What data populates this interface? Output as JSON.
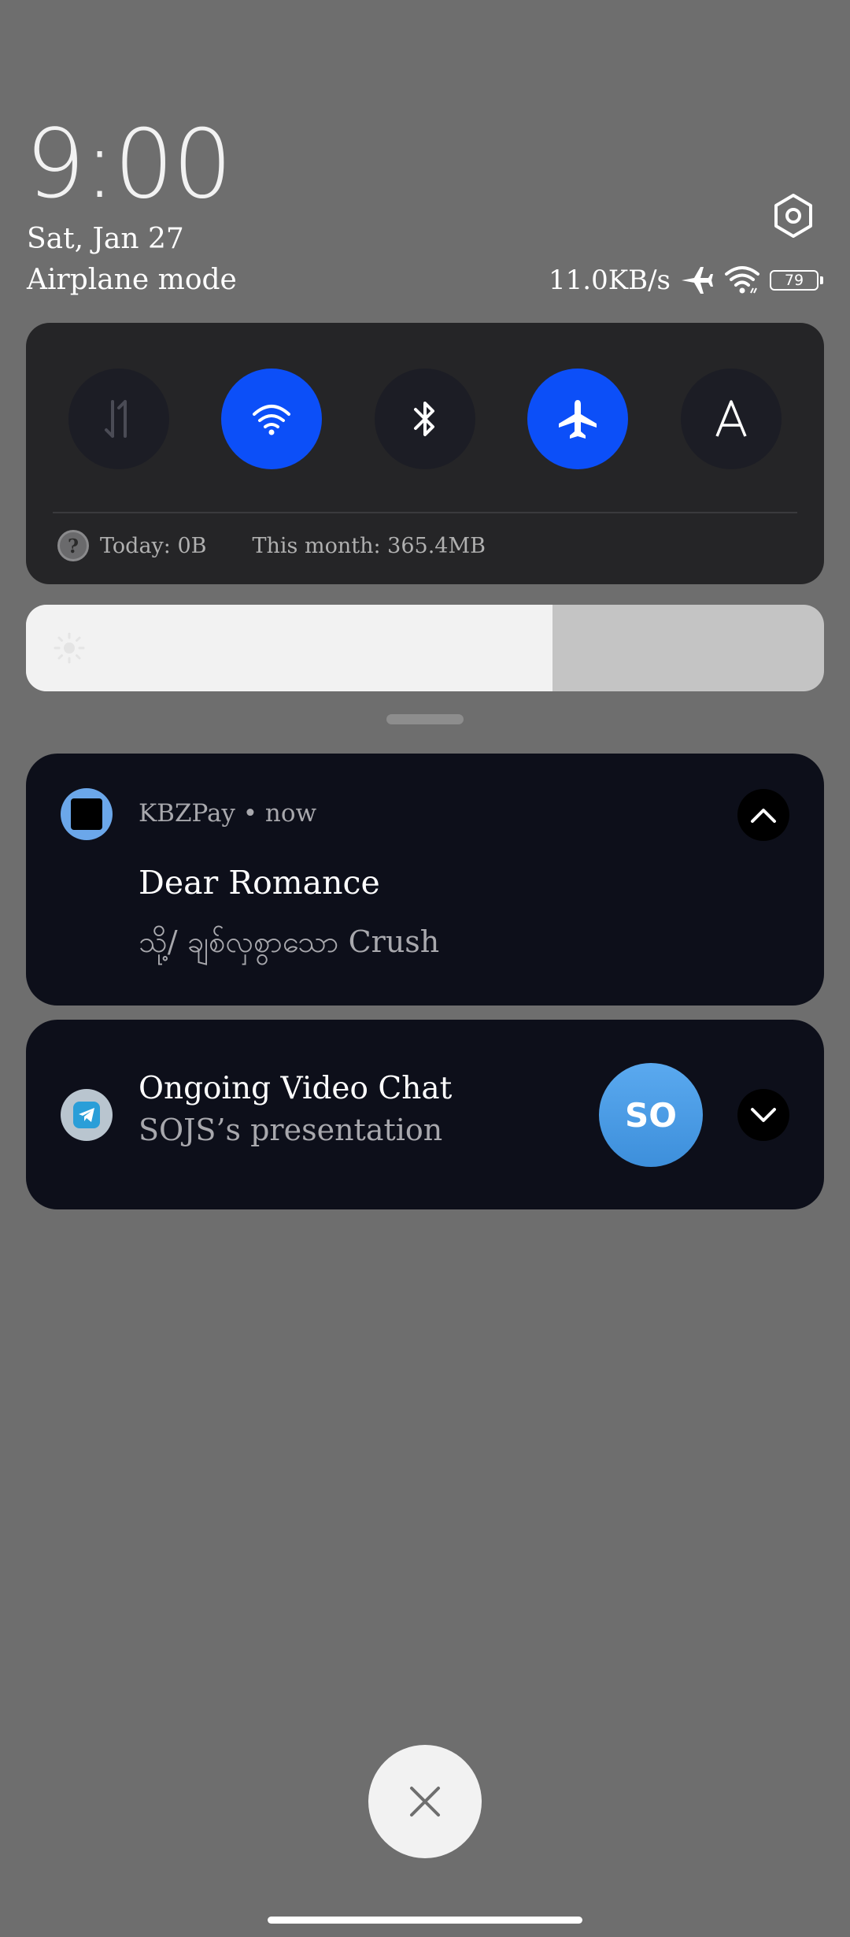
{
  "header": {
    "time": "9:00",
    "date": "Sat, Jan 27",
    "mode": "Airplane mode",
    "net_speed": "11.0KB/s",
    "battery_level": "79"
  },
  "quick_settings": {
    "tiles": [
      {
        "name": "mobile-data",
        "icon": "data-arrows-icon",
        "active": false
      },
      {
        "name": "wifi",
        "icon": "wifi-icon",
        "active": true
      },
      {
        "name": "bluetooth",
        "icon": "bluetooth-icon",
        "active": false
      },
      {
        "name": "airplane-mode",
        "icon": "airplane-icon",
        "active": true
      },
      {
        "name": "auto-brightness",
        "icon": "letter-a-icon",
        "active": false
      }
    ],
    "usage_today": "Today: 0B",
    "usage_month": "This month: 365.4MB"
  },
  "brightness": {
    "level": 0.66
  },
  "notifications": [
    {
      "app": "KBZPay",
      "time": "now",
      "meta": "KBZPay • now",
      "title": "Dear Romance",
      "body": "သို့/ ချစ်လှစွာသော Crush",
      "expanded": true
    },
    {
      "title": "Ongoing Video Chat",
      "subtitle": "SOJS’s presentation",
      "avatar_initials": "SO",
      "expanded": false
    }
  ],
  "colors": {
    "background": "#6e6e6e",
    "panel": "#252527",
    "accent": "#0c4ff8",
    "card": "#0d0f1a",
    "avatar": "#4a9be6"
  }
}
